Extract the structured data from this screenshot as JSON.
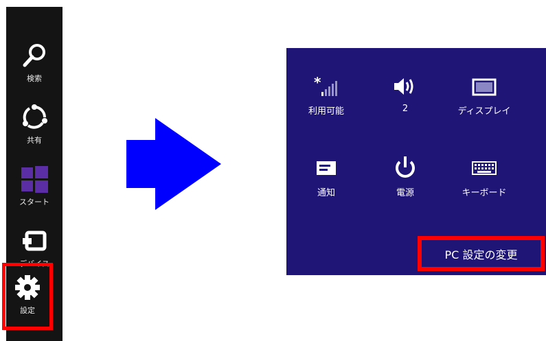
{
  "charms": {
    "search_label": "検索",
    "share_label": "共有",
    "start_label": "スタート",
    "devices_label": "デバイス",
    "settings_label": "設定"
  },
  "settings_pane": {
    "network_label": "利用可能",
    "volume_label": "2",
    "display_label": "ディスプレイ",
    "notifications_label": "通知",
    "power_label": "電源",
    "keyboard_label": "キーボード",
    "change_pc_settings_label": "PC 設定の変更"
  },
  "colors": {
    "charms_background": "#141414",
    "start_tile": "#5b2ea6",
    "pane_background": "#1e1576",
    "highlight": "#ff0000",
    "arrow": "#0000ff"
  },
  "icons": [
    "search-icon",
    "share-icon",
    "windows-logo-icon",
    "devices-icon",
    "gear-icon",
    "signal-icon",
    "speaker-icon",
    "display-icon",
    "notification-icon",
    "power-icon",
    "keyboard-icon",
    "right-arrow-icon"
  ]
}
